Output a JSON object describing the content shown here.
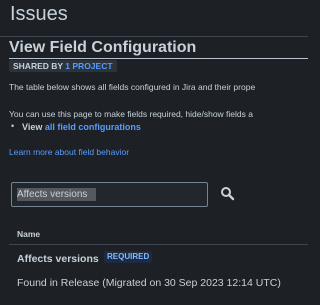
{
  "app": {
    "title": "Issues"
  },
  "page": {
    "title": "View Field Configuration",
    "shared_by_prefix": "SHARED BY",
    "shared_by_link": "1 PROJECT",
    "description_1": "The table below shows all fields configured in Jira and their prope",
    "description_2": "You can use this page to make fields required, hide/show fields a",
    "bullet_prefix": "View",
    "bullet_link": "all field configurations",
    "learn_more": "Learn more about field behavior"
  },
  "search": {
    "value": "Affects versions",
    "icon": "search-icon"
  },
  "table": {
    "columns": [
      "Name"
    ],
    "rows": [
      {
        "name": "Affects versions",
        "badge": "REQUIRED",
        "detail": "Found in Release (Migrated on 30 Sep 2023 12:14 UTC)"
      }
    ]
  },
  "colors": {
    "background": "#1d2125",
    "text": "#c7d1db",
    "link": "#579dff",
    "badge_bg": "#1c2b41",
    "badge_text": "#85b8ff"
  }
}
